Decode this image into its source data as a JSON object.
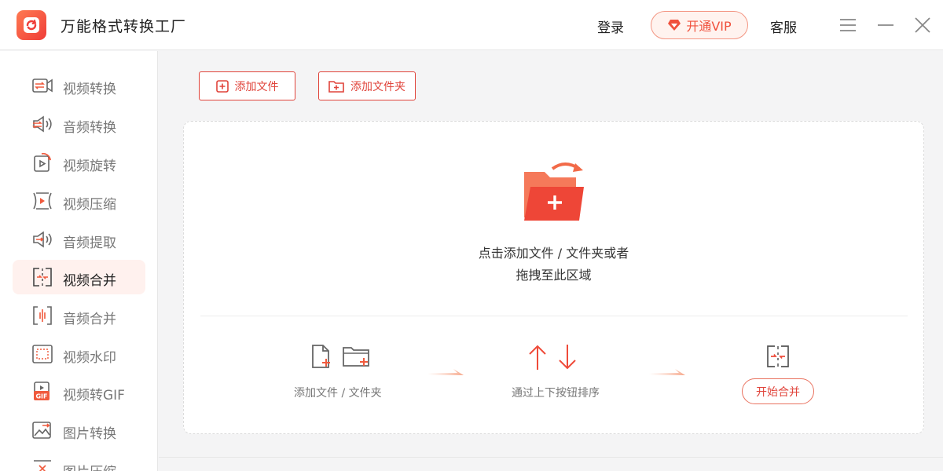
{
  "app": {
    "title": "万能格式转换工厂"
  },
  "header": {
    "login_label": "登录",
    "vip_label": "开通VIP",
    "service_label": "客服"
  },
  "colors": {
    "accent": "#e0433a",
    "accent_light": "#fff1ee"
  },
  "sidebar": {
    "items": [
      {
        "label": "视频转换",
        "icon": "video-convert-icon"
      },
      {
        "label": "音频转换",
        "icon": "audio-convert-icon"
      },
      {
        "label": "视频旋转",
        "icon": "video-rotate-icon"
      },
      {
        "label": "视频压缩",
        "icon": "video-compress-icon"
      },
      {
        "label": "音频提取",
        "icon": "audio-extract-icon"
      },
      {
        "label": "视频合并",
        "icon": "video-merge-icon",
        "active": true
      },
      {
        "label": "音频合并",
        "icon": "audio-merge-icon"
      },
      {
        "label": "视频水印",
        "icon": "video-watermark-icon"
      },
      {
        "label": "视频转GIF",
        "icon": "video-to-gif-icon"
      },
      {
        "label": "图片转换",
        "icon": "image-convert-icon"
      },
      {
        "label": "图片压缩",
        "icon": "image-compress-icon"
      }
    ]
  },
  "toolbar": {
    "add_file_label": "添加文件",
    "add_folder_label": "添加文件夹"
  },
  "drop_zone": {
    "line1": "点击添加文件 / 文件夹或者",
    "line2": "拖拽至此区域"
  },
  "steps": {
    "step1_label": "添加文件 / 文件夹",
    "step2_label": "通过上下按钮排序",
    "step3_button": "开始合并"
  }
}
